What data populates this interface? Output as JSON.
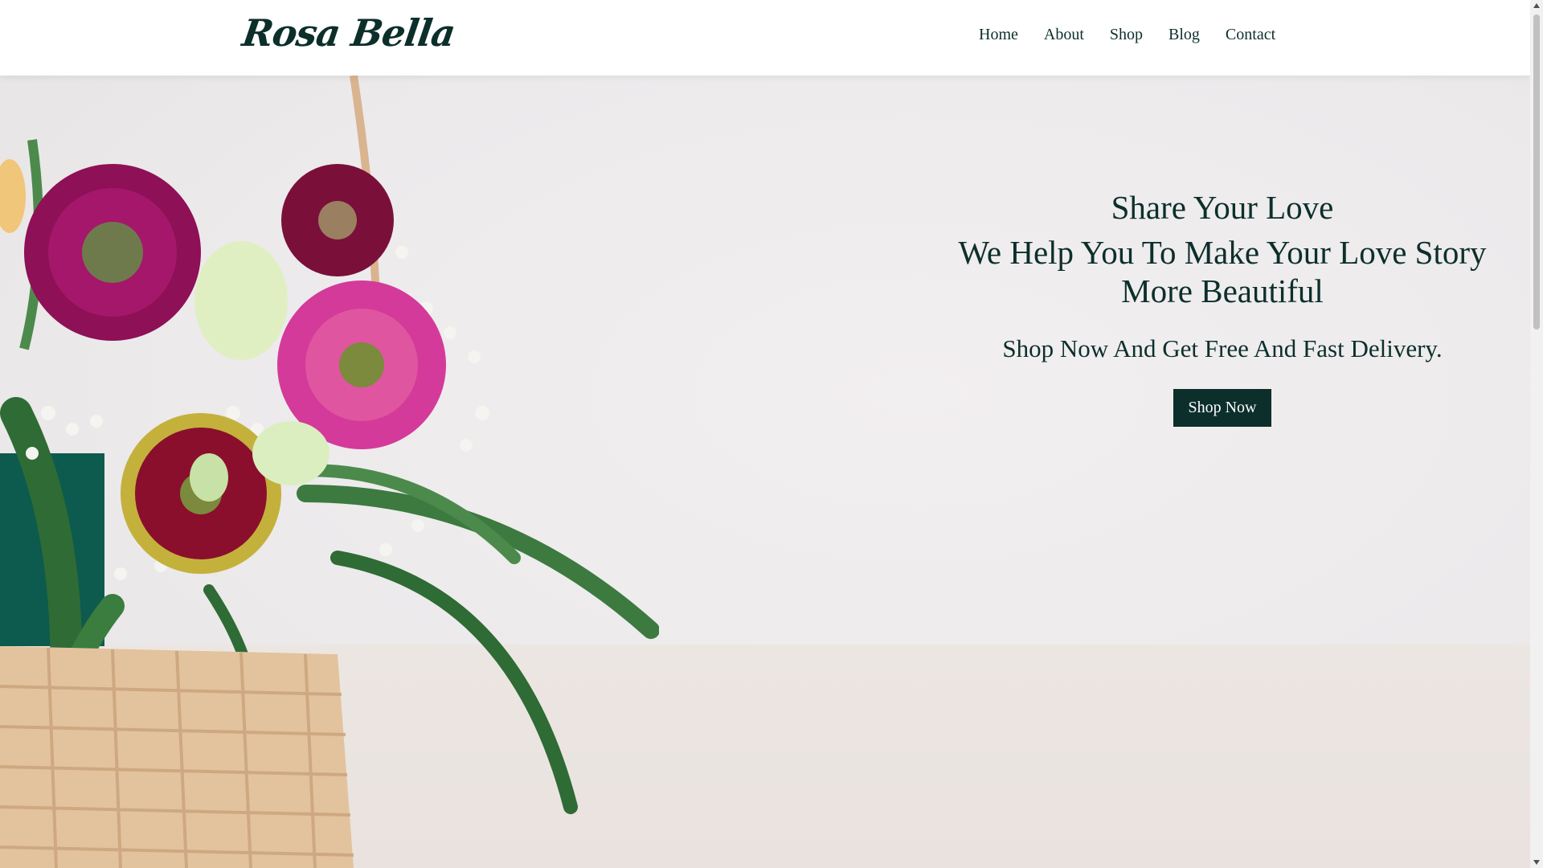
{
  "brand": {
    "logo_text": "Rosa Bella"
  },
  "nav": {
    "items": [
      {
        "label": "Home"
      },
      {
        "label": "About"
      },
      {
        "label": "Shop"
      },
      {
        "label": "Blog"
      },
      {
        "label": "Contact"
      }
    ]
  },
  "hero": {
    "subheading": "Share Your Love",
    "heading": "We Help You To Make Your Love Story More Beautiful",
    "tagline": "Shop Now And Get Free And Fast Delivery.",
    "cta_label": "Shop Now",
    "image_name": "flower-basket-image"
  },
  "colors": {
    "primary": "#0c2f2b",
    "header_bg": "#ffffff",
    "hero_bg": "#eceaeb"
  }
}
